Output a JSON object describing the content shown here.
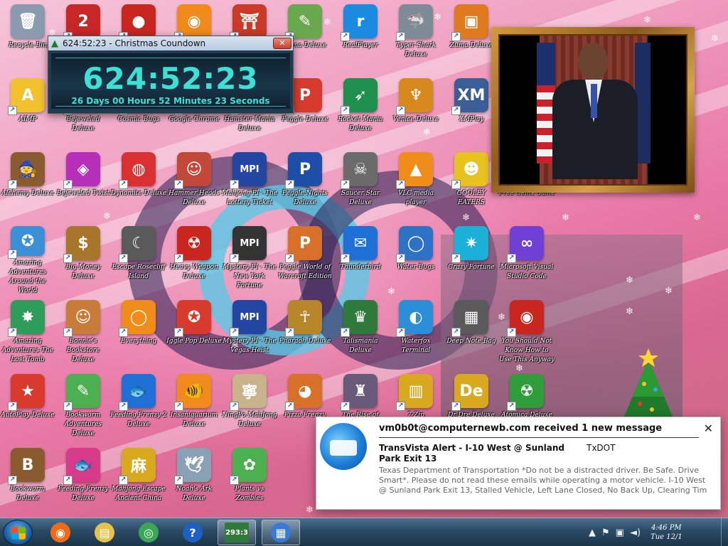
{
  "desktop": {
    "icons": [
      {
        "label": "Recycle Bin",
        "glyph": "🗑",
        "color": "#8a9bb0"
      },
      {
        "label": "2",
        "glyph": "2",
        "color": "#c72727"
      },
      {
        "label": "",
        "glyph": "●",
        "color": "#c8261e"
      },
      {
        "label": "",
        "glyph": "◉",
        "color": "#f08a1c"
      },
      {
        "label": "",
        "glyph": "⛩",
        "color": "#c93a28"
      },
      {
        "label": "Zuma Deluxe",
        "glyph": "✎",
        "color": "#6aa84f"
      },
      {
        "label": "RealPlayer",
        "glyph": "r",
        "color": "#1a8be0"
      },
      {
        "label": "Typer Shark Deluxe",
        "glyph": "🦈",
        "color": "#7e8a95"
      },
      {
        "label": "Zuma Deluxe",
        "glyph": "▣",
        "color": "#e07a1e"
      },
      {
        "label": "AIMP",
        "glyph": "A",
        "color": "#f2c12e"
      },
      {
        "label": "Bejeweled Deluxe",
        "glyph": "◆",
        "color": "#2b6fd6"
      },
      {
        "label": "Cosmic Bugs",
        "glyph": "✦",
        "color": "#3a3a3a"
      },
      {
        "label": "Google Chrome",
        "glyph": "◎",
        "color": "#3aa757"
      },
      {
        "label": "Hamster Mania Deluxe",
        "glyph": "✿",
        "color": "#9a6a3c"
      },
      {
        "label": "Peggle Deluxe",
        "glyph": "P",
        "color": "#d83a2e"
      },
      {
        "label": "Rocket Mania Deluxe",
        "glyph": "➶",
        "color": "#1f8f4d"
      },
      {
        "label": "Venice Deluxe",
        "glyph": "♆",
        "color": "#d8891e"
      },
      {
        "label": "XMPlay",
        "glyph": "XM",
        "color": "#3a5f98"
      },
      {
        "label": "Alchemy Deluxe",
        "glyph": "🧙",
        "color": "#8a5b2f"
      },
      {
        "label": "Bejeweled Twist",
        "glyph": "◈",
        "color": "#b52fb8"
      },
      {
        "label": "Dynomite Deluxe",
        "glyph": "◍",
        "color": "#d93131"
      },
      {
        "label": "Hammer Heads Deluxe",
        "glyph": "☺",
        "color": "#c2483a"
      },
      {
        "label": "Mahjong PI - The Lottery Ticket",
        "glyph": "MPI",
        "color": "#2446a3"
      },
      {
        "label": "Peggle Nights Deluxe",
        "glyph": "P",
        "color": "#1e4ea8"
      },
      {
        "label": "Saucer Star Deluxe",
        "glyph": "☠",
        "color": "#6b6b6b"
      },
      {
        "label": "VLC media player",
        "glyph": "▲",
        "color": "#f08c1a"
      },
      {
        "label": "GOOLEY EATERS",
        "glyph": "☻",
        "color": "#e8c21e"
      },
      {
        "label": "Free Gems Game",
        "glyph": "",
        "color": "transparent"
      },
      {
        "label": "Amazing Adventures Around the World",
        "glyph": "✪",
        "color": "#3a8fd6"
      },
      {
        "label": "Big Money Deluxe",
        "glyph": "$",
        "color": "#a8762a"
      },
      {
        "label": "Escape Rosecliff Island",
        "glyph": "☾",
        "color": "#5a5a5a"
      },
      {
        "label": "Heavy Weapon Deluxe",
        "glyph": "☢",
        "color": "#c8261e"
      },
      {
        "label": "Mystery PI - The New York Fortune",
        "glyph": "MPI",
        "color": "#333"
      },
      {
        "label": "Peggle World of Warcraft Edition",
        "glyph": "P",
        "color": "#d8702a"
      },
      {
        "label": "Thunderbird",
        "glyph": "✉",
        "color": "#1e6fd6"
      },
      {
        "label": "Water Bugs",
        "glyph": "◯",
        "color": "#2d72c4"
      },
      {
        "label": "Crazy Fortune",
        "glyph": "✷",
        "color": "#1ab0d8"
      },
      {
        "label": "Microsoft Visual Studio Code",
        "glyph": "∞",
        "color": "#6f3fd6"
      },
      {
        "label": "Amazing Adventures The Lost Tomb",
        "glyph": "✸",
        "color": "#2f9d5a"
      },
      {
        "label": "Bonnie's Bookstore Deluxe",
        "glyph": "☺",
        "color": "#c87c3a"
      },
      {
        "label": "Everything",
        "glyph": "◯",
        "color": "#f08c1a"
      },
      {
        "label": "Iggle Pop Deluxe",
        "glyph": "✪",
        "color": "#d83a2e"
      },
      {
        "label": "Mystery PI - The Vegas Heist",
        "glyph": "MPI",
        "color": "#2446a3"
      },
      {
        "label": "Pharaoh Deluxe",
        "glyph": "☥",
        "color": "#b8862a"
      },
      {
        "label": "Talismania Deluxe",
        "glyph": "♛",
        "color": "#2f7a3a"
      },
      {
        "label": "Waterfox Terminal",
        "glyph": "◐",
        "color": "#2a8fd6"
      },
      {
        "label": "Deep Note Bag",
        "glyph": "▦",
        "color": "#5a5a5a"
      },
      {
        "label": "You Should Not Know How to Use This Anyway",
        "glyph": "◉",
        "color": "#c8261e"
      },
      {
        "label": "AutoPlay Deluxe",
        "glyph": "★",
        "color": "#d83a2e"
      },
      {
        "label": "Bookworm Adventures Deluxe",
        "glyph": "✎",
        "color": "#4caf50"
      },
      {
        "label": "Feeding Frenzy 2 Deluxe",
        "glyph": "🐟",
        "color": "#1f6fd6"
      },
      {
        "label": "Insaniquarium Deluxe",
        "glyph": "🐠",
        "color": "#f08a1c"
      },
      {
        "label": "NingPo MahJong Deluxe",
        "glyph": "寧",
        "color": "#c8b38a"
      },
      {
        "label": "Pizza Frenzy",
        "glyph": "◕",
        "color": "#d8702a"
      },
      {
        "label": "The Rise of Atlantis",
        "glyph": "♜",
        "color": "#6a5a7a"
      },
      {
        "label": "7-Zip",
        "glyph": "▥",
        "color": "#d8a81e"
      },
      {
        "label": "Dr Dre Deluxe",
        "glyph": "De",
        "color": "#d8a81e"
      },
      {
        "label": "Atomica Deluxe",
        "glyph": "☢",
        "color": "#2f9d3a"
      },
      {
        "label": "Bookworm Deluxe",
        "glyph": "B",
        "color": "#8a5b2f"
      },
      {
        "label": "Feeding Frenzy Deluxe",
        "glyph": "🐟",
        "color": "#d83a8a"
      },
      {
        "label": "Mahjong Escape Ancient China",
        "glyph": "麻",
        "color": "#d8a81e"
      },
      {
        "label": "Noah's Ark Deluxe",
        "glyph": "🕊",
        "color": "#8aa0b5"
      },
      {
        "label": "Plants vs Zombies",
        "glyph": "✿",
        "color": "#4caf50"
      }
    ]
  },
  "countdown_window": {
    "title": "624:52:23 - Christmas Coundown",
    "tree_icon": "tree-icon",
    "time": "624:52:23",
    "detail": "26 Days 00 Hours 52 Minutes 23 Seconds",
    "close": "✕"
  },
  "notification": {
    "header": "vm0b0t@computernewb.com received 1 new message",
    "subject": "TransVista Alert - I-10 West @ Sunland Park Exit 13",
    "sender": "TxDOT",
    "body": "Texas Department of Transportation *Do not be a distracted driver. Be Safe. Drive Smart*. Please do not read these emails while operating a motor vehicle. I-10 West @ Sunland Park Exit 13, Stalled Vehicle, Left Lane Closed, No Back Up, Clearing Tim",
    "close": "✕"
  },
  "taskbar": {
    "start": "start-button",
    "pinned": [
      {
        "name": "firefox",
        "glyph": "◉",
        "color": "#f06a1a"
      },
      {
        "name": "file-explorer",
        "glyph": "▤",
        "color": "#e8c14a"
      },
      {
        "name": "chrome",
        "glyph": "◎",
        "color": "#3aa757"
      },
      {
        "name": "help",
        "glyph": "?",
        "color": "#1e5fc4"
      },
      {
        "name": "countdown",
        "glyph": "293:3",
        "color": "#2f7a3a"
      },
      {
        "name": "control-panel",
        "glyph": "▦",
        "color": "#3a7ad6"
      }
    ],
    "clock_line1": "4:46 PM",
    "clock_line2": "Tue 12/1"
  }
}
